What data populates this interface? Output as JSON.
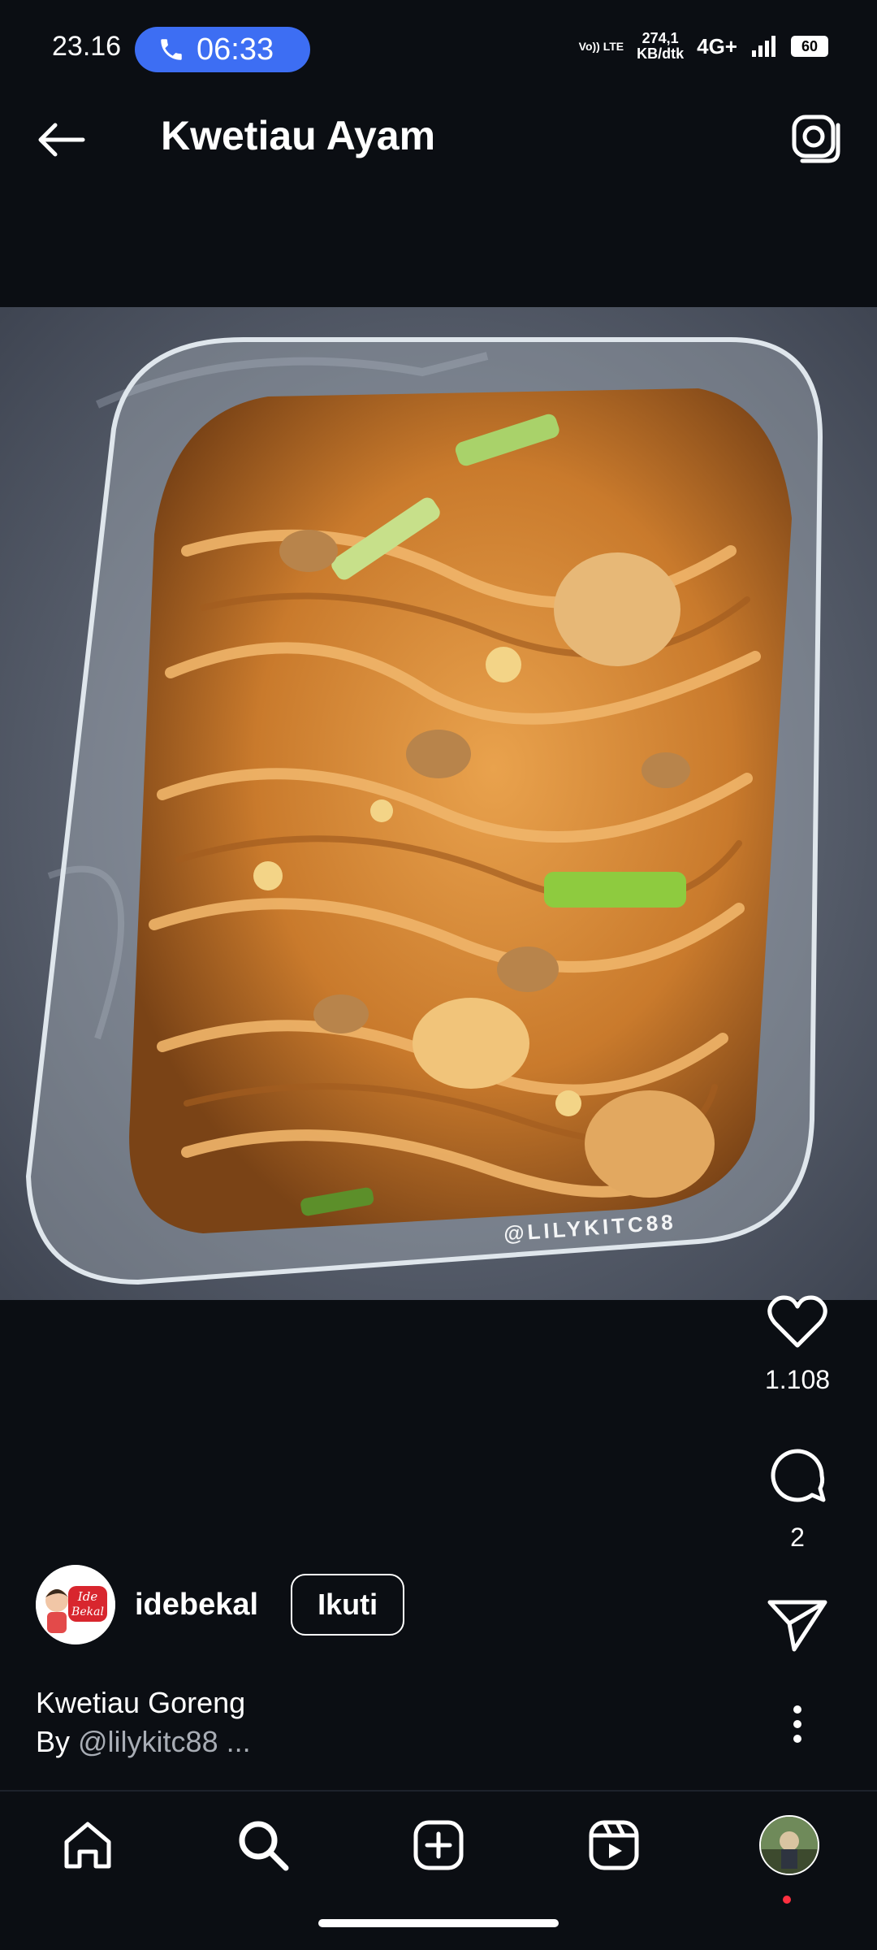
{
  "status_bar": {
    "time": "23.16",
    "call_timer": "06:33",
    "volte": "Vo)) LTE",
    "data_rate_line1": "274,1",
    "data_rate_line2": "KB/dtk",
    "network": "4G+",
    "battery": "60"
  },
  "header": {
    "title": "Kwetiau Ayam"
  },
  "post": {
    "image_alt": "Kwetiau goreng in glass dish",
    "watermark": "@LILYKITC88",
    "likes": "1.108",
    "comments": "2",
    "author": "idebekal",
    "avatar_text": "Ide Bekal",
    "follow_label": "Ikuti",
    "caption_line1": "Kwetiau Goreng",
    "caption_by": "By ",
    "caption_handle": "@lilykitc88",
    "caption_more": " ..."
  },
  "icons": {
    "back": "arrow-left-icon",
    "camera": "camera-icon",
    "like": "heart-icon",
    "comment": "comment-icon",
    "share": "send-icon",
    "more": "more-vertical-icon",
    "home": "home-icon",
    "search": "search-icon",
    "create": "plus-square-icon",
    "reels": "reels-icon"
  },
  "colors": {
    "background": "#0b0e13",
    "call_pill": "#3d6ef3",
    "notification_dot": "#ff3040"
  }
}
